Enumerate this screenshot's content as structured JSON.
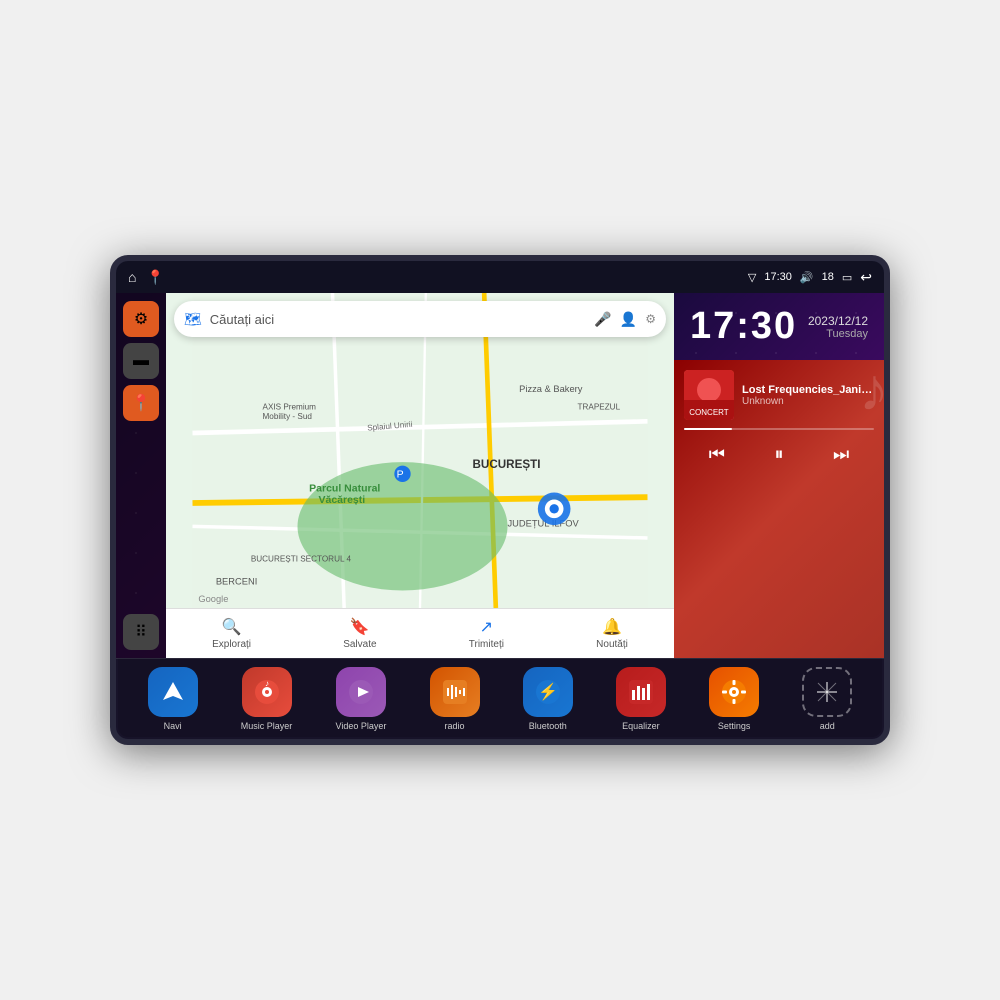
{
  "device": {
    "frame_color": "#1a1a2e"
  },
  "status_bar": {
    "time": "17:30",
    "battery_level": "18",
    "signal_icon": "▼",
    "wifi_label": "wifi",
    "volume_label": "volume",
    "back_label": "back",
    "home_label": "home",
    "map_label": "map"
  },
  "map": {
    "search_placeholder": "Căutați aici",
    "location1": "AXIS Premium Mobility - Sud",
    "location2": "Parcul Natural Văcărești",
    "location3": "Pizza & Bakery",
    "location4": "BUCUREȘTI",
    "location5": "BUCUREȘTI SECTORUL 4",
    "location6": "BERCENI",
    "location7": "JUDEȚUL ILFOV",
    "location8": "TRAPEZUL",
    "road1": "Splaiul Unirii",
    "google_label": "Google",
    "bottom_items": [
      {
        "icon": "📍",
        "label": "Explorați"
      },
      {
        "icon": "🔖",
        "label": "Salvate"
      },
      {
        "icon": "↗",
        "label": "Trimiteți"
      },
      {
        "icon": "🔔",
        "label": "Noutăți"
      }
    ]
  },
  "clock": {
    "time": "17:30",
    "date": "2023/12/12",
    "weekday": "Tuesday"
  },
  "music": {
    "title": "Lost Frequencies_Janie...",
    "artist": "Unknown",
    "progress_percent": 25,
    "controls": {
      "prev": "⏮",
      "pause": "⏸",
      "next": "⏭"
    }
  },
  "sidebar": {
    "items": [
      {
        "icon": "⚙",
        "color": "orange",
        "label": "settings"
      },
      {
        "icon": "▬",
        "color": "gray",
        "label": "file-manager"
      },
      {
        "icon": "📍",
        "color": "orange",
        "label": "navigation"
      },
      {
        "icon": "▶",
        "color": "gray",
        "label": "menu",
        "bottom": true
      }
    ]
  },
  "apps": [
    {
      "id": "navi",
      "icon": "➤",
      "label": "Navi",
      "color_class": "navi"
    },
    {
      "id": "music",
      "icon": "♪",
      "label": "Music Player",
      "color_class": "music"
    },
    {
      "id": "video",
      "icon": "▶",
      "label": "Video Player",
      "color_class": "video"
    },
    {
      "id": "radio",
      "icon": "📻",
      "label": "radio",
      "color_class": "radio"
    },
    {
      "id": "bluetooth",
      "icon": "⚡",
      "label": "Bluetooth",
      "color_class": "bluetooth"
    },
    {
      "id": "equalizer",
      "icon": "≡",
      "label": "Equalizer",
      "color_class": "equalizer"
    },
    {
      "id": "settings",
      "icon": "⚙",
      "label": "Settings",
      "color_class": "settings"
    },
    {
      "id": "add",
      "icon": "+",
      "label": "add",
      "color_class": "add"
    }
  ]
}
